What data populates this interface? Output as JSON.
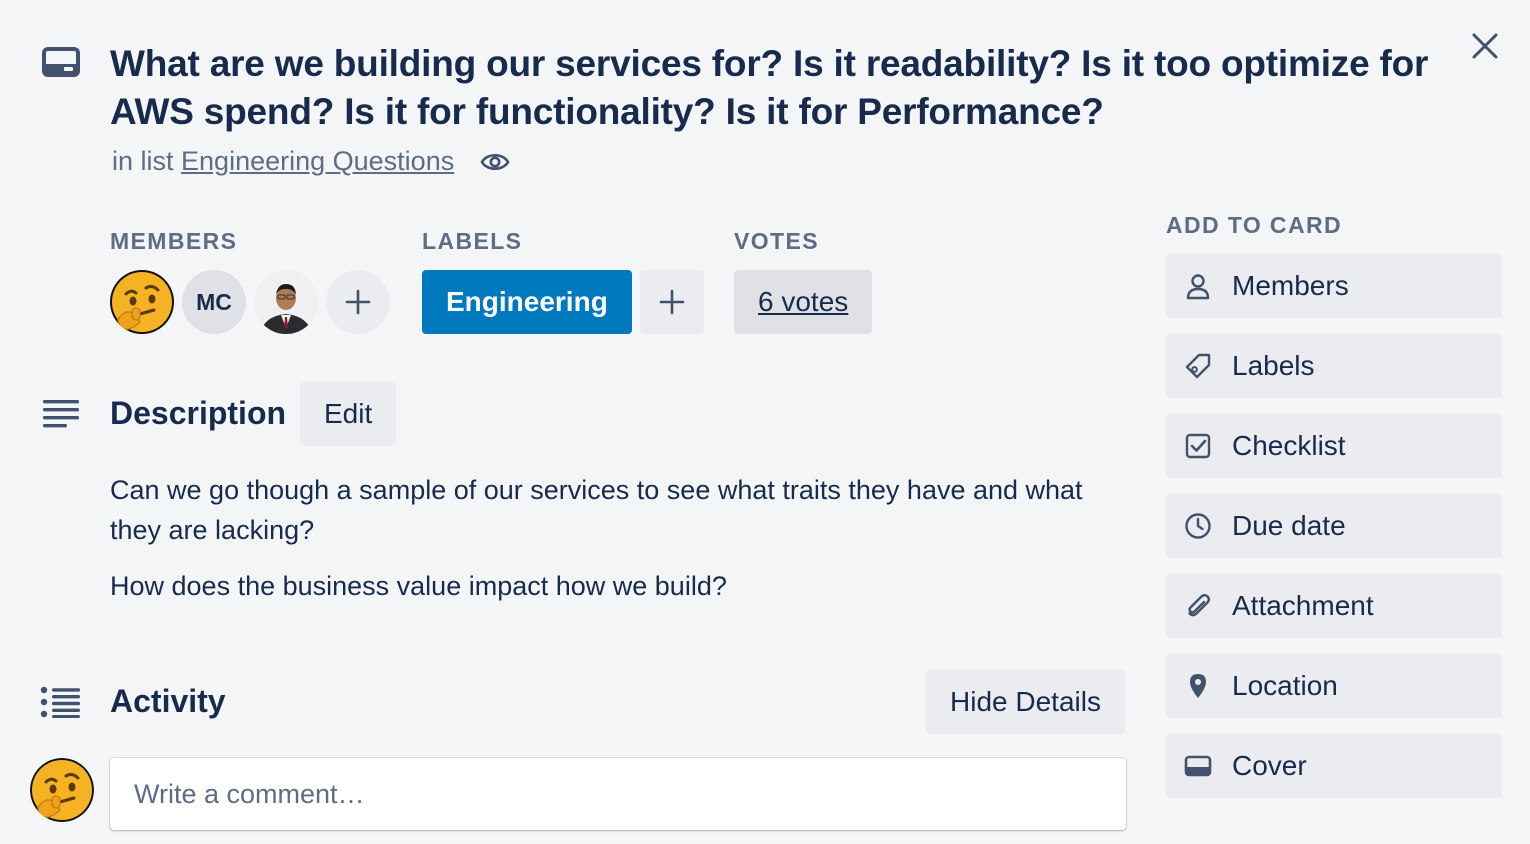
{
  "card": {
    "title": "What are we building our services for? Is it readability? Is it too optimize for AWS spend? Is it for functionality? Is it for Performance?",
    "in_list_prefix": "in list",
    "list_name": "Engineering Questions"
  },
  "members": {
    "header": "MEMBERS",
    "initials": "MC"
  },
  "labels": {
    "header": "LABELS",
    "items": [
      "Engineering"
    ],
    "color": "#0079bf"
  },
  "votes": {
    "header": "VOTES",
    "label": "6 votes"
  },
  "description": {
    "title": "Description",
    "edit_label": "Edit",
    "paragraphs": [
      "Can we go though a sample of our services to see what traits they have and what they are lacking?",
      "How does the business value impact how we build?"
    ]
  },
  "activity": {
    "title": "Activity",
    "hide_details_label": "Hide Details",
    "comment_placeholder": "Write a comment…"
  },
  "sidebar": {
    "header": "ADD TO CARD",
    "items": [
      {
        "label": "Members",
        "icon": "person-icon"
      },
      {
        "label": "Labels",
        "icon": "tag-icon"
      },
      {
        "label": "Checklist",
        "icon": "checkbox-icon"
      },
      {
        "label": "Due date",
        "icon": "clock-icon"
      },
      {
        "label": "Attachment",
        "icon": "paperclip-icon"
      },
      {
        "label": "Location",
        "icon": "map-pin-icon"
      },
      {
        "label": "Cover",
        "icon": "cover-icon"
      }
    ]
  },
  "colors": {
    "background": "#f4f5f7",
    "text": "#172b4d",
    "muted": "#5e6c84",
    "button": "#ebecf0"
  }
}
